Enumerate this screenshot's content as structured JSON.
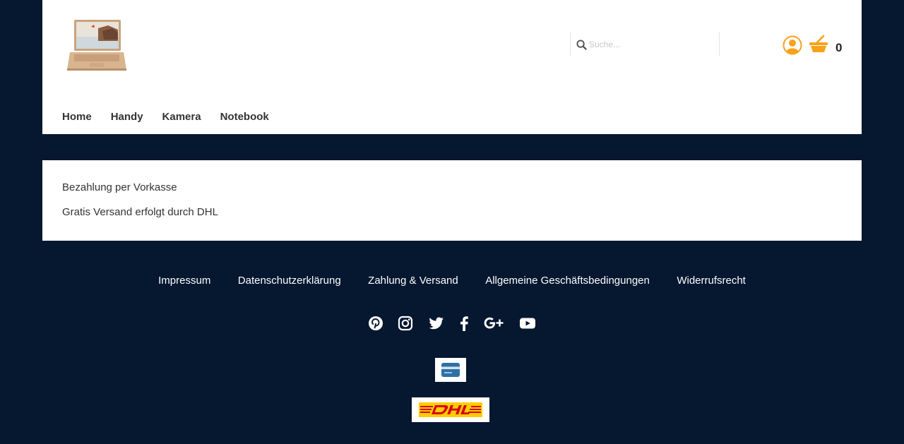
{
  "search": {
    "placeholder": "Suche..."
  },
  "cart": {
    "count": "0"
  },
  "nav": {
    "items": [
      {
        "label": "Home"
      },
      {
        "label": "Handy"
      },
      {
        "label": "Kamera"
      },
      {
        "label": "Notebook"
      }
    ]
  },
  "content": {
    "line1": "Bezahlung per Vorkasse",
    "line2": "Gratis Versand erfolgt durch DHL"
  },
  "footer": {
    "links": [
      {
        "label": "Impressum"
      },
      {
        "label": "Datenschutzerklärung"
      },
      {
        "label": "Zahlung & Versand"
      },
      {
        "label": "Allgemeine Geschäftsbedingungen"
      },
      {
        "label": "Widerrufsrecht"
      }
    ],
    "social_icons": [
      "pinterest-icon",
      "instagram-icon",
      "twitter-icon",
      "facebook-icon",
      "google-plus-icon",
      "youtube-icon"
    ],
    "payment_icons": [
      "credit-card-icon",
      "dhl-logo"
    ]
  },
  "colors": {
    "background": "#061730",
    "panel": "#ffffff",
    "accent": "#f7a21b",
    "dhl_yellow": "#ffcc00",
    "dhl_red": "#d40511"
  }
}
